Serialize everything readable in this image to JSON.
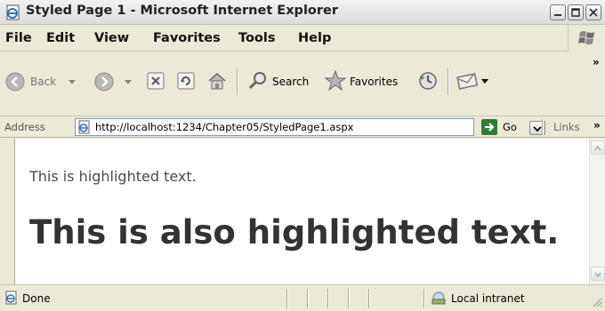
{
  "window": {
    "title": "Styled Page 1 - Microsoft Internet Explorer"
  },
  "menu": {
    "items": [
      "File",
      "Edit",
      "View",
      "Favorites",
      "Tools",
      "Help"
    ]
  },
  "toolbar": {
    "back_label": "Back",
    "search_label": "Search",
    "favorites_label": "Favorites",
    "overflow_label": "»"
  },
  "address_bar": {
    "label": "Address",
    "url": "http://localhost:1234/Chapter05/StyledPage1.aspx",
    "go_label": "Go",
    "links_label": "Links",
    "links_overflow": "»"
  },
  "content": {
    "text_small": "This is highlighted text.",
    "text_big": "This is also highlighted text."
  },
  "status_bar": {
    "status": "Done",
    "zone": "Local intranet"
  },
  "colors": {
    "chrome": "#ece9d8",
    "back_icon": "#9e9e9e",
    "go_green": "#2e7d32",
    "favorites_star": "#8a8a8a"
  }
}
